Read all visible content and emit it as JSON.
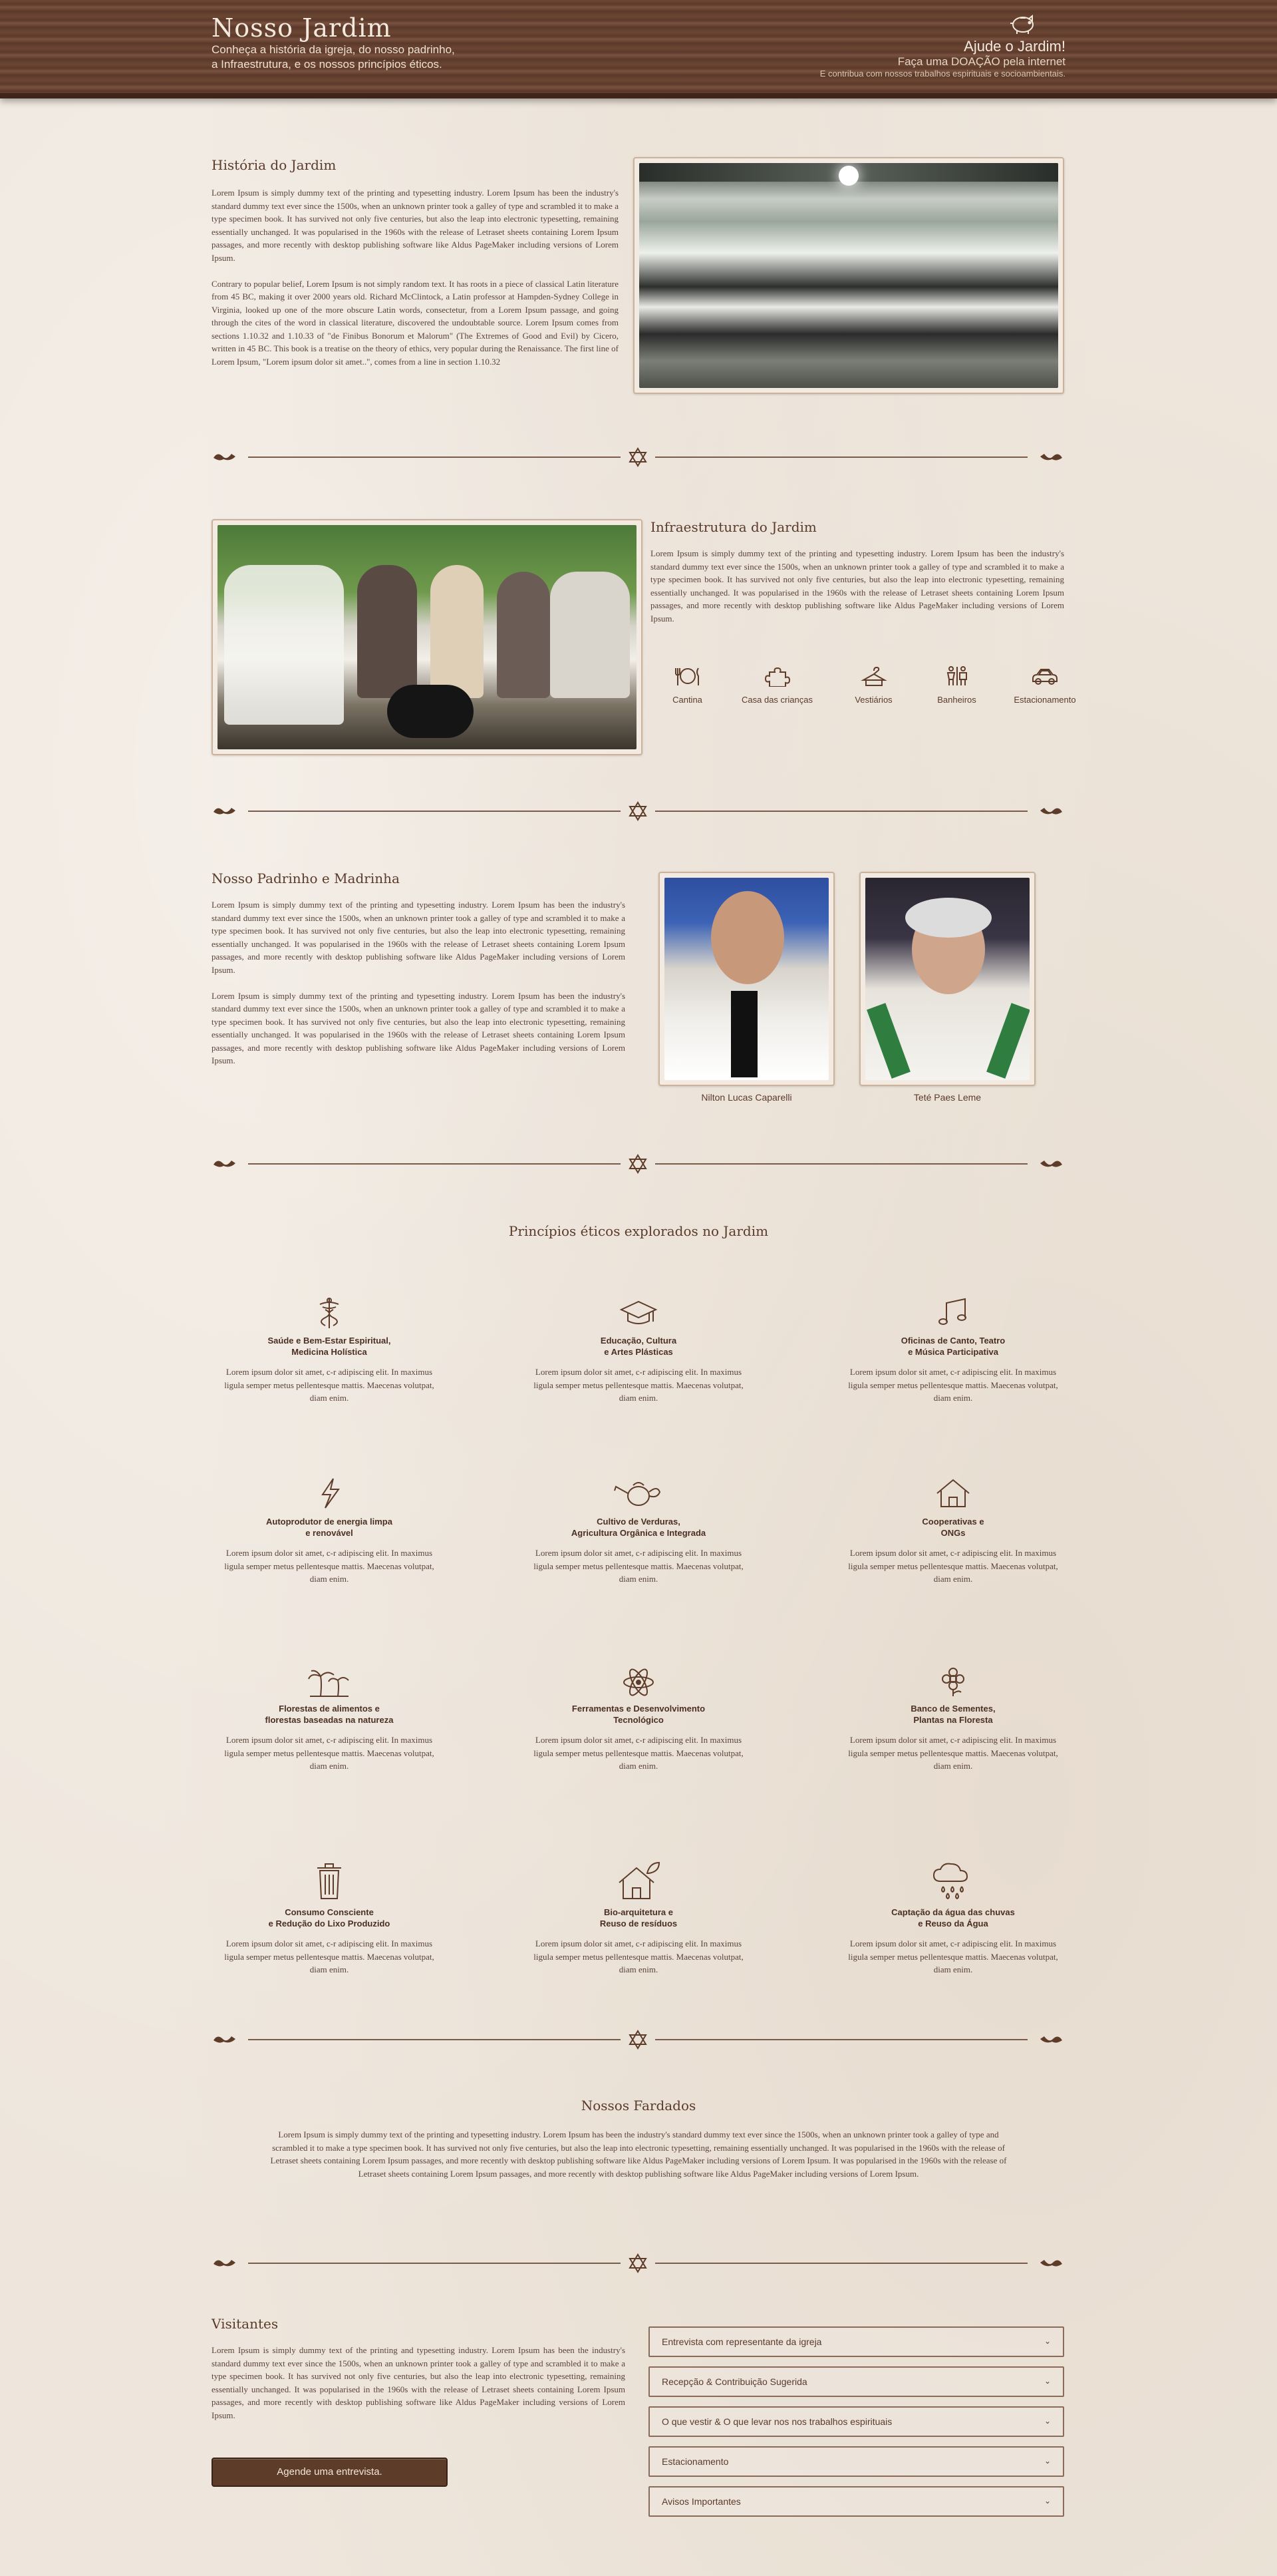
{
  "header": {
    "title": "Nosso Jardim",
    "subtitle_line1": "Conheça a história da igreja, do nosso padrinho,",
    "subtitle_line2": "a Infraestrutura, e os nossos princípios éticos.",
    "donate_title": "Ajude o Jardim!",
    "donate_sub": "Faça uma DOAÇÃO pela internet",
    "donate_note": "E contribua com nossos trabalhos espirituais e socioambientais."
  },
  "historia": {
    "title": "História do Jardim",
    "p1": "Lorem Ipsum is simply dummy text of the printing and typesetting industry. Lorem Ipsum has been the industry's standard dummy text ever since the 1500s, when an unknown printer took a galley of type and scrambled it to make a type specimen book. It has survived not only five centuries, but also the leap into electronic typesetting, remaining essentially unchanged. It was popularised in the 1960s with the release of Letraset sheets containing Lorem Ipsum passages, and more recently with desktop publishing software like Aldus PageMaker including versions of Lorem Ipsum.",
    "p2": "Contrary to popular belief, Lorem Ipsum is not simply random text. It has roots in a piece of classical Latin literature from 45 BC, making it over 2000 years old. Richard McClintock, a Latin professor at Hampden-Sydney College in Virginia, looked up one of the more obscure Latin words, consectetur, from a Lorem Ipsum passage, and going through the cites of the word in classical literature, discovered the undoubtable source. Lorem Ipsum comes from sections 1.10.32 and 1.10.33 of \"de Finibus Bonorum et Malorum\" (The Extremes of Good and Evil) by Cicero, written in 45 BC. This book is a treatise on the theory of ethics, very popular during the Renaissance. The first line of Lorem Ipsum, \"Lorem ipsum dolor sit amet..\", comes from a line in section 1.10.32"
  },
  "infra": {
    "title": "Infraestrutura do Jardim",
    "p1": "Lorem Ipsum is simply dummy text of the printing and typesetting industry. Lorem Ipsum has been the industry's standard dummy text ever since the 1500s, when an unknown printer took a galley of type and scrambled it to make a type specimen book. It has survived not only five centuries, but also the leap into electronic typesetting, remaining essentially unchanged. It was popularised in the 1960s with the release of Letraset sheets containing Lorem Ipsum passages, and more recently with desktop publishing software like Aldus PageMaker including versions of Lorem Ipsum.",
    "amenities": [
      {
        "icon": "utensils-icon",
        "label": "Cantina"
      },
      {
        "icon": "puzzle-icon",
        "label": "Casa das crianças"
      },
      {
        "icon": "hanger-icon",
        "label": "Vestiários"
      },
      {
        "icon": "restroom-icon",
        "label": "Banheiros"
      },
      {
        "icon": "car-icon",
        "label": "Estacionamento"
      }
    ]
  },
  "padrinho": {
    "title": "Nosso Padrinho e Madrinha",
    "p1": "Lorem Ipsum is simply dummy text of the printing and typesetting industry. Lorem Ipsum has been the industry's standard dummy text ever since the 1500s, when an unknown printer took a galley of type and scrambled it to make a type specimen book. It has survived not only five centuries, but also the leap into electronic typesetting, remaining essentially unchanged. It was popularised in the 1960s with the release of Letraset sheets containing Lorem Ipsum passages, and more recently with desktop publishing software like Aldus PageMaker including versions of Lorem Ipsum.",
    "p2": "Lorem Ipsum is simply dummy text of the printing and typesetting industry. Lorem Ipsum has been the industry's standard dummy text ever since the 1500s, when an unknown printer took a galley of type and scrambled it to make a type specimen book. It has survived not only five centuries, but also the leap into electronic typesetting, remaining essentially unchanged. It was popularised in the 1960s with the release of Letraset sheets containing Lorem Ipsum passages, and more recently with desktop publishing software like Aldus PageMaker including versions of Lorem Ipsum.",
    "name1": "Nilton Lucas Caparelli",
    "name2": "Teté Paes Leme"
  },
  "principios": {
    "title": "Princípios éticos explorados no Jardim",
    "desc": "Lorem ipsum dolor sit amet, c-r adipiscing elit. In maximus ligula semper metus pellentesque mattis. Maecenas volutpat, diam enim.",
    "items": [
      {
        "icon": "caduceus-icon",
        "title": "Saúde e Bem-Estar Espiritual,\nMedicina Holística"
      },
      {
        "icon": "graduation-cap-icon",
        "title": "Educação, Cultura\ne Artes Plásticas"
      },
      {
        "icon": "music-note-icon",
        "title": "Oficinas de Canto, Teatro\ne Música Participativa"
      },
      {
        "icon": "lightning-icon",
        "title": "Autoprodutor de energia limpa\ne renovável"
      },
      {
        "icon": "watering-can-icon",
        "title": "Cultivo de Verduras,\nAgricultura Orgânica e Integrada"
      },
      {
        "icon": "house-icon",
        "title": "Cooperativas e\nONGs"
      },
      {
        "icon": "palm-trees-icon",
        "title": "Florestas de alimentos e\nflorestas baseadas na natureza"
      },
      {
        "icon": "atom-icon",
        "title": "Ferramentas e Desenvolvimento\nTecnológico"
      },
      {
        "icon": "flower-icon",
        "title": "Banco de Sementes,\nPlantas na Floresta"
      },
      {
        "icon": "trash-can-icon",
        "title": "Consumo Consciente\ne Redução do Lixo Produzido"
      },
      {
        "icon": "leaf-house-icon",
        "title": "Bio-arquitetura e\nReuso de resíduos"
      },
      {
        "icon": "rain-cloud-icon",
        "title": "Captação da água das chuvas\ne Reuso da Água"
      }
    ]
  },
  "fardados": {
    "title": "Nossos Fardados",
    "p1": "Lorem Ipsum is simply dummy text of the printing and typesetting industry. Lorem Ipsum has been the industry's standard dummy text ever since the 1500s, when an unknown printer took a galley of type and scrambled it to make a type specimen book. It has survived not only five centuries, but also the leap into electronic typesetting, remaining essentially unchanged. It was popularised in the 1960s with the release of Letraset sheets containing Lorem Ipsum passages, and more recently with desktop publishing software like Aldus PageMaker including versions of Lorem Ipsum. It was popularised in the 1960s with the release of Letraset sheets containing Lorem Ipsum passages, and more recently with desktop publishing software like Aldus PageMaker including versions of Lorem Ipsum."
  },
  "visitantes": {
    "title": "Visitantes",
    "p1": "Lorem Ipsum is simply dummy text of the printing and typesetting industry. Lorem Ipsum has been the industry's standard dummy text ever since the 1500s, when an unknown printer took a galley of type and scrambled it to make a type specimen book. It has survived not only five centuries, but also the leap into electronic typesetting, remaining essentially unchanged. It was popularised in the 1960s with the release of Letraset sheets containing Lorem Ipsum passages, and more recently with desktop publishing software like Aldus PageMaker including versions of Lorem Ipsum.",
    "button": "Agende uma entrevista.",
    "accordion": [
      "Entrevista com representante da igreja",
      "Recepção & Contribuição Sugerida",
      "O que vestir & O que levar nos nos trabalhos espirituais",
      "Estacionamento",
      "Avisos Importantes"
    ]
  }
}
